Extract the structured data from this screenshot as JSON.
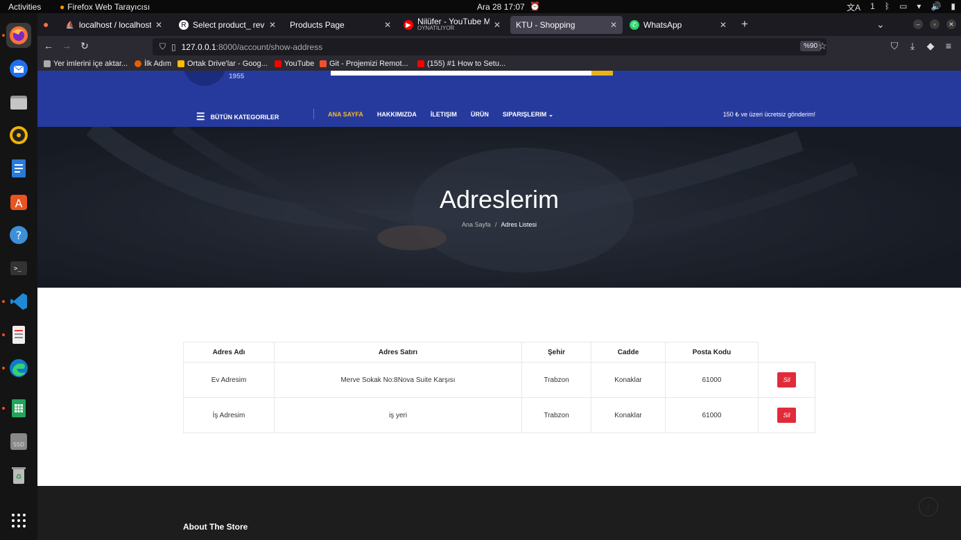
{
  "os": {
    "activities": "Activities",
    "app_name": "Firefox Web Tarayıcısı",
    "clock": "Ara 28  17:07",
    "tray": [
      "文A",
      "1",
      "ᛒ",
      "▭",
      "▾",
      "🔊",
      "▮"
    ]
  },
  "dock": {
    "items": [
      "firefox-icon",
      "thunderbird-icon",
      "files-icon",
      "rhythmbox-icon",
      "writer-icon",
      "app-center-icon",
      "help-icon",
      "terminal-icon",
      "vscode-icon",
      "text-editor-icon",
      "edge-icon",
      "calc-icon",
      "ssd-icon",
      "trash-icon",
      "show-apps-icon"
    ]
  },
  "tabs": [
    {
      "title": "localhost / localhost / ec",
      "favicon": "#f89c0e",
      "active": false
    },
    {
      "title": "Select product_ review to",
      "favicon": "#ffffff",
      "active": false
    },
    {
      "title": "Products Page",
      "favicon": "",
      "active": false
    },
    {
      "title": "Nilüfer - YouTube Music",
      "subtitle": "OYNATILIYOR",
      "favicon": "#ff0000",
      "active": false
    },
    {
      "title": "KTU - Shopping",
      "favicon": "",
      "active": true
    },
    {
      "title": "WhatsApp",
      "favicon": "#25d366",
      "active": false
    }
  ],
  "browser": {
    "url_host": "127.0.0.1",
    "url_path": ":8000/account/show-address",
    "zoom": "%90",
    "new_tab": "+",
    "bookmarks": [
      {
        "label": "Yer imlerini içe aktar...",
        "color": "#aaaaaa"
      },
      {
        "label": "İlk Adım",
        "color": "#e66000"
      },
      {
        "label": "Ortak Drive'lar - Goog...",
        "color": "#fbbc04"
      },
      {
        "label": "YouTube",
        "color": "#ff0000"
      },
      {
        "label": "Git - Projemizi Remot...",
        "color": "#f05032"
      },
      {
        "label": "(155) #1 How to Setu...",
        "color": "#ff0000"
      }
    ]
  },
  "site": {
    "logo_year": "1955",
    "categories_label": "BÜTÜN KATEGORILER",
    "menu": [
      {
        "label": "ANA SAYFA",
        "active": true
      },
      {
        "label": "HAKKIMIZDA",
        "active": false
      },
      {
        "label": "İLETIŞIM",
        "active": false
      },
      {
        "label": "ÜRÜN",
        "active": false
      },
      {
        "label": "SIPARIŞLERIM",
        "active": false,
        "dropdown": true
      }
    ],
    "shipping_note": "150 ₺ ve üzeri ücretsiz gönderim!",
    "accent_color": "#f5b928",
    "header_color": "#263a9e"
  },
  "hero": {
    "title": "Adreslerim",
    "breadcrumb_home": "Ana Sayfa",
    "breadcrumb_sep": "/",
    "breadcrumb_current": "Adres Listesi"
  },
  "addresses": {
    "columns": [
      "Adres Adı",
      "Adres Satırı",
      "Şehir",
      "Cadde",
      "Posta Kodu",
      ""
    ],
    "rows": [
      {
        "name": "Ev Adresim",
        "line": "Merve Sokak No:8Nova Suite Karşısı",
        "city": "Trabzon",
        "street": "Konaklar",
        "zip": "61000",
        "action": "Sil"
      },
      {
        "name": "İş Adresim",
        "line": "iş yeri",
        "city": "Trabzon",
        "street": "Konaklar",
        "zip": "61000",
        "action": "Sil"
      }
    ]
  },
  "footer": {
    "title": "About The Store"
  }
}
